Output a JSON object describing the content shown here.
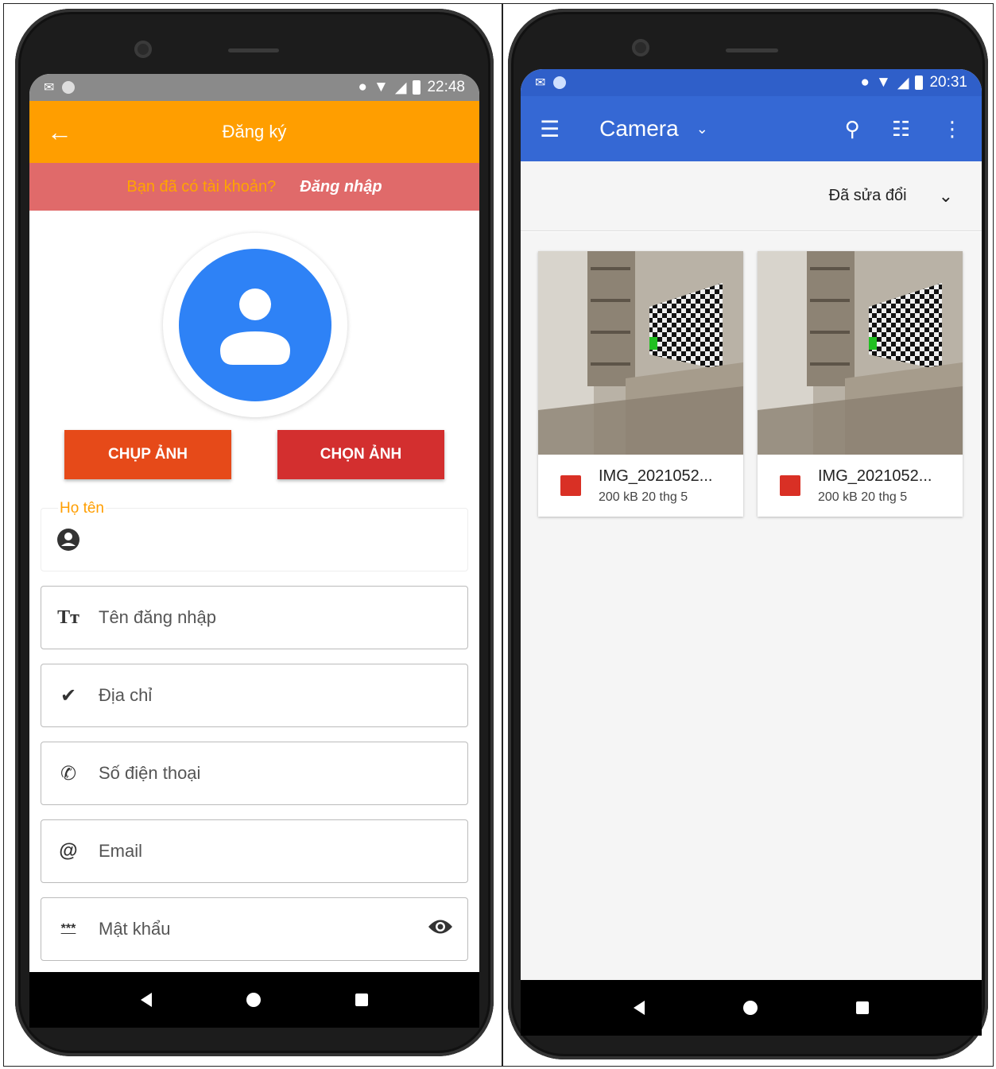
{
  "left": {
    "status": {
      "time": "22:48"
    },
    "header": {
      "title": "Đăng ký"
    },
    "login_prompt": {
      "question": "Bạn đã có tài khoản?",
      "link": "Đăng nhập"
    },
    "buttons": {
      "capture": "CHỤP ẢNH",
      "choose": "CHỌN ẢNH"
    },
    "fields": {
      "fullname_label": "Họ tên",
      "username": "Tên đăng nhập",
      "address": "Địa chỉ",
      "phone": "Số điện thoại",
      "email": "Email",
      "password": "Mật khẩu"
    },
    "colors": {
      "appbar": "#ff9e00",
      "loginbar": "#e06a6a",
      "capture": "#e64a19",
      "choose": "#d32f2f",
      "avatar": "#2e82f6"
    }
  },
  "right": {
    "status": {
      "time": "20:31"
    },
    "header": {
      "title": "Camera"
    },
    "sort": {
      "label": "Đã sửa đổi"
    },
    "files": [
      {
        "name": "IMG_2021052...",
        "meta": "200 kB 20 thg 5"
      },
      {
        "name": "IMG_2021052...",
        "meta": "200 kB 20 thg 5"
      }
    ],
    "colors": {
      "appbar": "#3568d4"
    }
  }
}
